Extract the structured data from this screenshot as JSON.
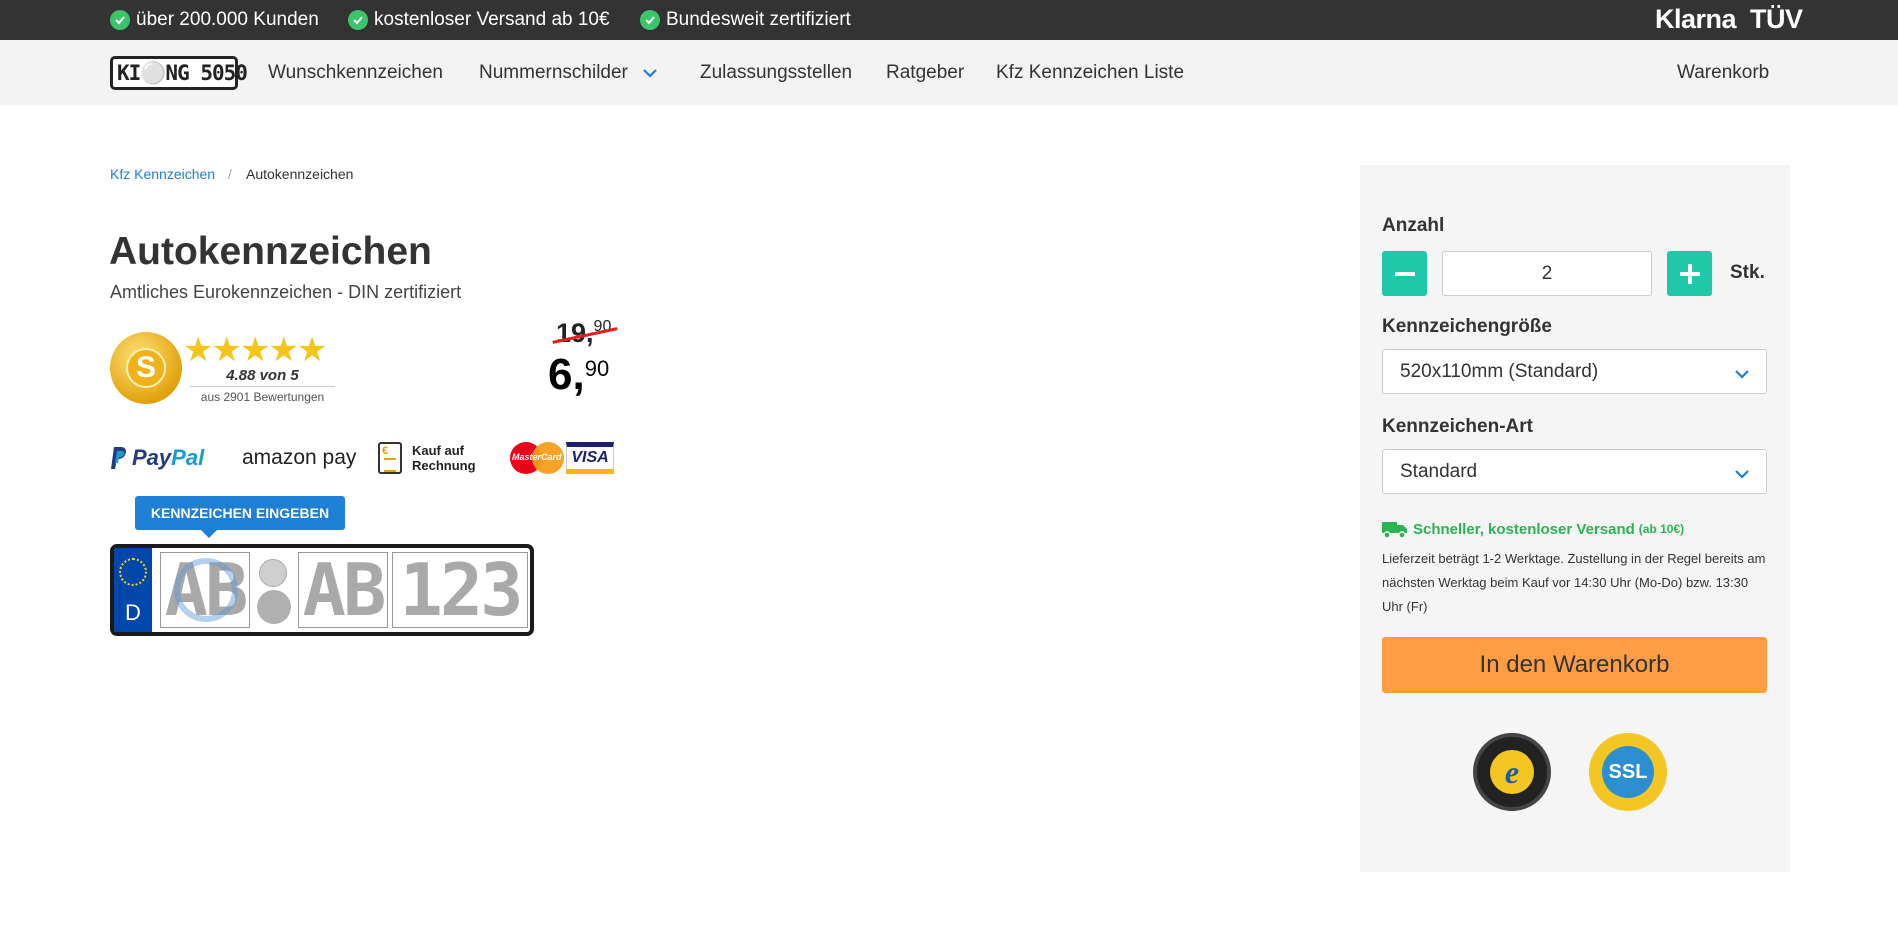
{
  "topbar": {
    "usps": [
      "über 200.000 Kunden",
      "kostenloser Versand ab 10€",
      "Bundesweit zertifiziert"
    ],
    "brand_klarna": "Klarna",
    "brand_tuv": "TÜV"
  },
  "nav": {
    "logo_text": "KI⚪NG 5050",
    "items": [
      "Wunschkennzeichen",
      "Nummernschilder",
      "Zulassungsstellen",
      "Ratgeber",
      "Kfz Kennzeichen Liste"
    ],
    "cart": "Warenkorb"
  },
  "breadcrumb": {
    "home": "Kfz Kennzeichen",
    "separator": "/",
    "current": "Autokennzeichen"
  },
  "product": {
    "title": "Autokennzeichen",
    "subtitle": "Amtliches Eurokennzeichen - DIN zertifiziert",
    "rating_seal_letter": "S",
    "stars": "★★★★★",
    "rating_text": "4.88 von 5",
    "rating_count": "aus 2901 Bewertungen",
    "old_price_main": "19,",
    "old_price_cents": "90",
    "price_main": "6,",
    "price_cents": "90"
  },
  "payments": {
    "paypal_1": "Pay",
    "paypal_2": "Pal",
    "amazon": "amazon pay",
    "rechnung": "Kauf auf\nRechnung",
    "mastercard": "MasterCard",
    "visa": "VISA"
  },
  "plate": {
    "tooltip": "KENNZEICHEN EINGEBEN",
    "country": "D",
    "city_placeholder": "AB",
    "letters_placeholder": "AB",
    "numbers_placeholder": "123"
  },
  "panel": {
    "quantity_label": "Anzahl",
    "quantity_value": "2",
    "unit": "Stk.",
    "size_label": "Kennzeichengröße",
    "size_value": "520x110mm (Standard)",
    "type_label": "Kennzeichen-Art",
    "type_value": "Standard",
    "shipping_title": "Schneller, kostenloser Versand",
    "shipping_small": "(ab 10€)",
    "shipping_info": "Lieferzeit beträgt 1-2 Werktage. Zustellung in der Regel bereits am nächsten Werktag beim Kauf vor 14:30 Uhr (Mo-Do) bzw. 13:30 Uhr (Fr)",
    "cart_button": "In den Warenkorb",
    "ssl_text": "SSL"
  },
  "colors": {
    "accent_teal": "#1fc8a8",
    "cart_orange": "#ff9d45",
    "link_blue": "#1e7fd6",
    "ship_green": "#2bb552",
    "topbar_bg": "#333333"
  }
}
